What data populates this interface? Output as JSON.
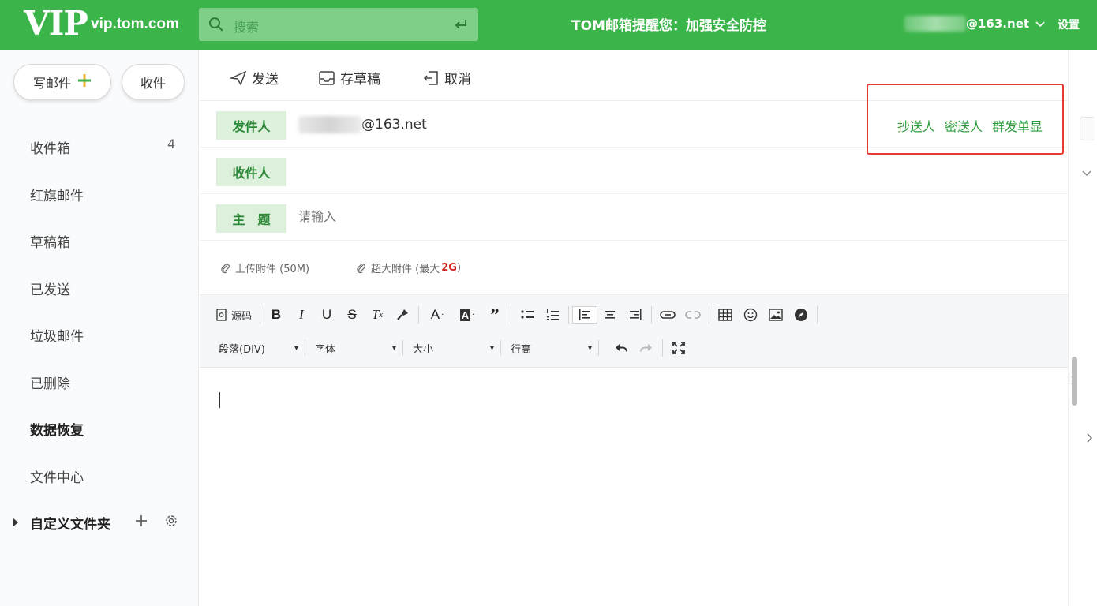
{
  "header": {
    "logo": "VIP",
    "domain": "vip.tom.com",
    "search_placeholder": "搜索",
    "notice": "TOM邮箱提醒您：加强安全防控",
    "account_suffix": "@163.net",
    "settings": "设置"
  },
  "sidebar": {
    "compose": "写邮件",
    "receive": "收件",
    "items": [
      {
        "label": "收件箱",
        "count": "4"
      },
      {
        "label": "红旗邮件"
      },
      {
        "label": "草稿箱"
      },
      {
        "label": "已发送"
      },
      {
        "label": "垃圾邮件"
      },
      {
        "label": "已删除"
      },
      {
        "label": "数据恢复"
      },
      {
        "label": "文件中心"
      }
    ],
    "custom_folders": "自定义文件夹"
  },
  "toolbar": {
    "send": "发送",
    "save_draft": "存草稿",
    "cancel": "取消"
  },
  "compose": {
    "sender_label": "发件人",
    "sender_suffix": "@163.net",
    "recipient_label": "收件人",
    "subject_label": "主　题",
    "subject_placeholder": "请输入",
    "cc": "抄送人",
    "bcc": "密送人",
    "group_single": "群发单显",
    "attach": "上传附件 (50M)",
    "big_attach_prefix": "超大附件 (最大 ",
    "big_attach_size": "2G",
    "big_attach_suffix": ")"
  },
  "editor": {
    "source": "源码",
    "paragraph": "段落(DIV)",
    "font": "字体",
    "size": "大小",
    "line_height": "行高"
  },
  "colors": {
    "brand_green": "#3bb54a",
    "label_bg": "#dcf0dc",
    "link_green": "#2e9b3d",
    "highlight_red": "#e53935"
  }
}
